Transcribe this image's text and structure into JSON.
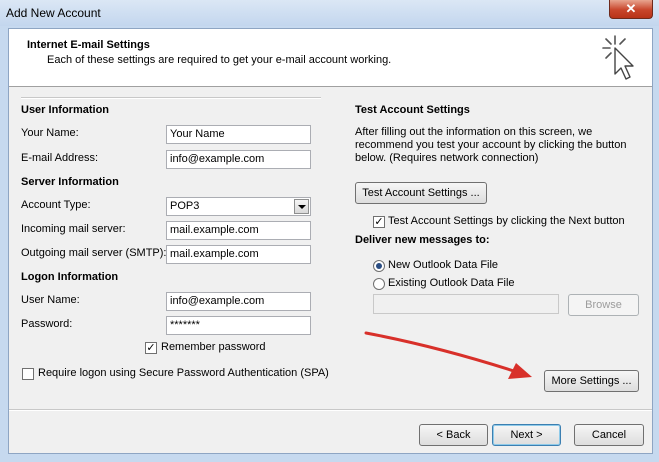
{
  "window": {
    "title": "Add New Account",
    "close_glyph": "✕"
  },
  "header": {
    "title": "Internet E-mail Settings",
    "subtitle": "Each of these settings are required to get your e-mail account working."
  },
  "user_info": {
    "heading": "User Information",
    "name_label": "Your Name:",
    "name_value": "Your Name",
    "email_label": "E-mail Address:",
    "email_value": "info@example.com"
  },
  "server_info": {
    "heading": "Server Information",
    "account_type_label": "Account Type:",
    "account_type_value": "POP3",
    "incoming_label": "Incoming mail server:",
    "incoming_value": "mail.example.com",
    "outgoing_label": "Outgoing mail server (SMTP):",
    "outgoing_value": "mail.example.com"
  },
  "logon_info": {
    "heading": "Logon Information",
    "username_label": "User Name:",
    "username_value": "info@example.com",
    "password_label": "Password:",
    "password_value": "*******",
    "remember_label": "Remember password",
    "remember_checked": true,
    "spa_label": "Require logon using Secure Password Authentication (SPA)",
    "spa_checked": false
  },
  "test_settings": {
    "heading": "Test Account Settings",
    "description_line1": "After filling out the information on this screen, we",
    "description_line2": "recommend you test your account by clicking the button",
    "description_line3": "below. (Requires network connection)",
    "test_button": "Test Account Settings ...",
    "auto_test_label": "Test Account Settings by clicking the Next button",
    "auto_test_checked": true
  },
  "deliver": {
    "heading": "Deliver new messages to:",
    "new_file_label": "New Outlook Data File",
    "existing_file_label": "Existing Outlook Data File",
    "selected": "new",
    "existing_path_value": "",
    "browse_button": "Browse"
  },
  "buttons": {
    "more_settings": "More Settings ...",
    "back": "< Back",
    "next": "Next >",
    "cancel": "Cancel"
  },
  "glyphs": {
    "check": "✓"
  },
  "colors": {
    "annotation_arrow": "#d8302a",
    "title_bar": "#c6d9ef",
    "close_button": "#c8452b"
  }
}
